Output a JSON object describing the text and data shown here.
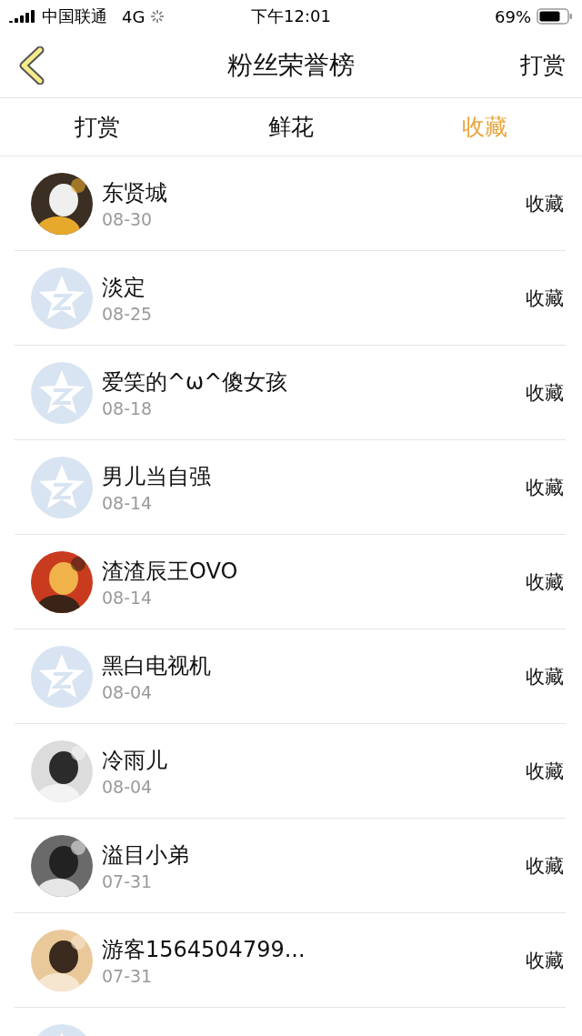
{
  "status_bar": {
    "carrier": "中国联通",
    "network": "4G",
    "time": "下午12:01",
    "battery": "69%"
  },
  "nav": {
    "title": "粉丝荣誉榜",
    "action": "打赏"
  },
  "tabs": [
    {
      "label": "打赏",
      "selected": false
    },
    {
      "label": "鲜花",
      "selected": false
    },
    {
      "label": "收藏",
      "selected": true
    }
  ],
  "rows": [
    {
      "name": "东贤城",
      "date": "08-30",
      "action": "收藏"
    },
    {
      "name": "淡定",
      "date": "08-25",
      "action": "收藏",
      "kind": "default"
    },
    {
      "name": "爱笑的^ω^傻女孩",
      "date": "08-18",
      "action": "收藏",
      "kind": "default"
    },
    {
      "name": "男儿当自强",
      "date": "08-14",
      "action": "收藏",
      "kind": "default"
    },
    {
      "name": "渣渣辰王OVO",
      "date": "08-14",
      "action": "收藏"
    },
    {
      "name": "黑白电视机",
      "date": "08-04",
      "action": "收藏",
      "kind": "default"
    },
    {
      "name": "冷雨儿",
      "date": "08-04",
      "action": "收藏"
    },
    {
      "name": "溢目小弟",
      "date": "07-31",
      "action": "收藏"
    },
    {
      "name": "游客1564504799...",
      "date": "07-31",
      "action": "收藏"
    },
    {
      "kind": "default"
    }
  ]
}
